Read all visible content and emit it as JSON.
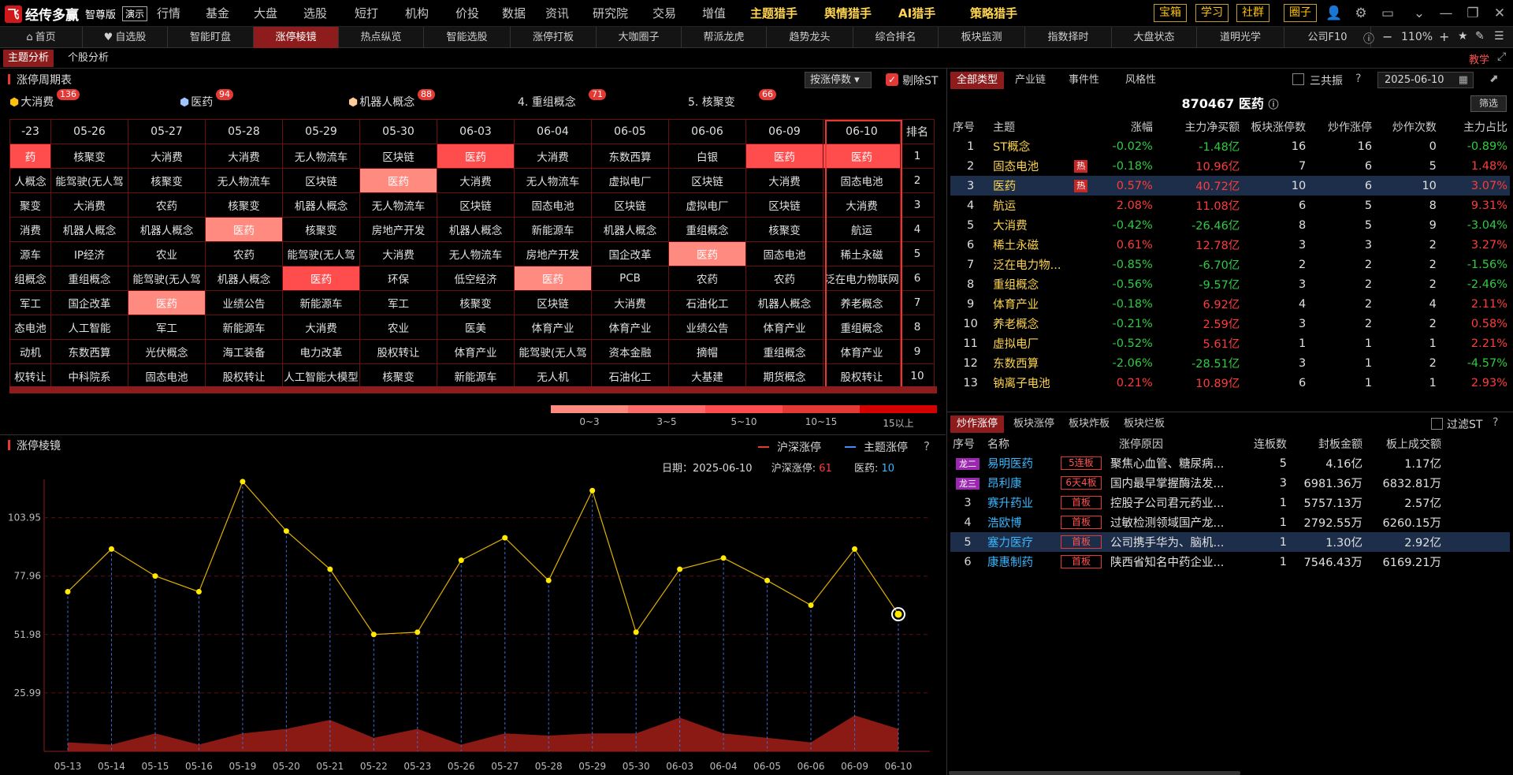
{
  "app": {
    "logo": "经传多赢",
    "edition": "智尊版",
    "demo": "演示"
  },
  "menu": [
    "行情",
    "基金",
    "大盘",
    "选股",
    "短打",
    "机构",
    "价投",
    "数据",
    "资讯",
    "研究院",
    "交易",
    "增值",
    "主题猎手",
    "舆情猎手",
    "AI猎手",
    "策略猎手"
  ],
  "top_buttons": [
    "宝箱",
    "学习",
    "社群",
    "圈子"
  ],
  "tabs": [
    "首页",
    "自选股",
    "智能盯盘",
    "涨停棱镜",
    "热点纵览",
    "智能选股",
    "涨停打板",
    "大咖圈子",
    "帮派龙虎",
    "趋势龙头",
    "综合排名",
    "板块监测",
    "指数择时",
    "大盘状态",
    "道明光学",
    "公司F10"
  ],
  "zoom": "110%",
  "teach": "教学",
  "subtabs": [
    "主题分析",
    "个股分析"
  ],
  "cycle": {
    "title": "涨停周期表",
    "sort": "按涨停数",
    "exclude_st": "剔除ST",
    "cats": [
      {
        "label": "大消费",
        "count": "136"
      },
      {
        "label": "医药",
        "count": "94"
      },
      {
        "label": "机器人概念",
        "count": "88"
      },
      {
        "label": "4. 重组概念",
        "count": "71"
      },
      {
        "label": "5. 核聚变",
        "count": "66"
      }
    ],
    "dates": [
      "-23",
      "05-26",
      "05-27",
      "05-28",
      "05-29",
      "05-30",
      "06-03",
      "06-04",
      "06-05",
      "06-06",
      "06-09",
      "06-10"
    ],
    "rank_header": "排名",
    "rows": [
      [
        "药",
        "核聚变",
        "大消费",
        "大消费",
        "无人物流车",
        "区块链",
        "医药",
        "大消费",
        "东数西算",
        "白银",
        "医药",
        "医药"
      ],
      [
        "人概念",
        "能驾驶(无人驾",
        "核聚变",
        "无人物流车",
        "区块链",
        "医药",
        "大消费",
        "无人物流车",
        "虚拟电厂",
        "区块链",
        "大消费",
        "固态电池"
      ],
      [
        "聚变",
        "大消费",
        "农药",
        "核聚变",
        "机器人概念",
        "无人物流车",
        "区块链",
        "固态电池",
        "区块链",
        "虚拟电厂",
        "区块链",
        "大消费"
      ],
      [
        "消费",
        "机器人概念",
        "机器人概念",
        "医药",
        "核聚变",
        "房地产开发",
        "机器人概念",
        "新能源车",
        "机器人概念",
        "重组概念",
        "核聚变",
        "航运"
      ],
      [
        "源车",
        "IP经济",
        "农业",
        "农药",
        "能驾驶(无人驾",
        "大消费",
        "无人物流车",
        "房地产开发",
        "国企改革",
        "医药",
        "固态电池",
        "稀土永磁"
      ],
      [
        "组概念",
        "重组概念",
        "能驾驶(无人驾",
        "机器人概念",
        "医药",
        "环保",
        "低空经济",
        "医药",
        "PCB",
        "农药",
        "农药",
        "泛在电力物联网"
      ],
      [
        "军工",
        "国企改革",
        "医药",
        "业绩公告",
        "新能源车",
        "军工",
        "核聚变",
        "区块链",
        "大消费",
        "石油化工",
        "机器人概念",
        "养老概念"
      ],
      [
        "态电池",
        "人工智能",
        "军工",
        "新能源车",
        "大消费",
        "农业",
        "医美",
        "体育产业",
        "体育产业",
        "业绩公告",
        "体育产业",
        "重组概念"
      ],
      [
        "动机",
        "东数西算",
        "光伏概念",
        "海工装备",
        "电力改革",
        "股权转让",
        "体育产业",
        "能驾驶(无人驾",
        "资本金融",
        "摘帽",
        "重组概念",
        "体育产业"
      ],
      [
        "权转让",
        "中科院系",
        "固态电池",
        "股权转让",
        "人工智能大模型",
        "核聚变",
        "新能源车",
        "无人机",
        "石油化工",
        "大基建",
        "期货概念",
        "股权转让"
      ]
    ],
    "hl": [
      [
        "r1",
        0,
        0
      ],
      [
        "r1",
        0,
        6
      ],
      [
        "r1",
        0,
        10
      ],
      [
        "r1",
        0,
        11
      ],
      [
        "r2",
        1,
        5
      ],
      [
        "r2",
        3,
        3
      ],
      [
        "r2",
        4,
        9
      ],
      [
        "r1",
        5,
        4
      ],
      [
        "r2",
        5,
        7
      ],
      [
        "r2",
        6,
        2
      ]
    ],
    "legend": [
      "0~3",
      "3~5",
      "5~10",
      "10~15",
      "15以上"
    ],
    "legend_colors": [
      "#ff8a80",
      "#ff6b6b",
      "#ff4d4d",
      "#e53935",
      "#d50000"
    ]
  },
  "prism": {
    "title": "涨停棱镜",
    "legend_a": "沪深涨停",
    "legend_b": "主题涨停",
    "date_label": "日期：",
    "date": "2025-06-10",
    "hs_label": "沪深涨停:",
    "hs_value": "61",
    "theme_label": "医药:",
    "theme_value": "10"
  },
  "chart_data": {
    "type": "line",
    "x": [
      "05-13",
      "05-14",
      "05-15",
      "05-16",
      "05-19",
      "05-20",
      "05-21",
      "05-22",
      "05-23",
      "05-26",
      "05-27",
      "05-28",
      "05-29",
      "05-30",
      "06-03",
      "06-04",
      "06-05",
      "06-06",
      "06-09",
      "06-10"
    ],
    "yticks": [
      "103.95",
      "77.96",
      "51.98",
      "25.99"
    ],
    "ylim": [
      0,
      121
    ],
    "series": [
      {
        "name": "沪深涨停",
        "values": [
          71,
          90,
          78,
          71,
          120,
          98,
          81,
          52,
          53,
          85,
          95,
          76,
          116,
          53,
          81,
          86,
          76,
          65,
          90,
          61
        ]
      },
      {
        "name": "主题涨停",
        "values": [
          4,
          3,
          8,
          3,
          8,
          10,
          14,
          6,
          10,
          3,
          8,
          7,
          8,
          8,
          15,
          8,
          6,
          4,
          16,
          10
        ]
      }
    ]
  },
  "theme_panel": {
    "tabs": [
      "全部类型",
      "产业链",
      "事件性",
      "风格性"
    ],
    "sanguo": "三共振",
    "date": "2025-06-10",
    "filter": "筛选",
    "stock": "870467 医药",
    "headers": [
      "序号",
      "主题",
      "涨幅",
      "主力净买额",
      "板块涨停数",
      "炒作涨停",
      "炒作次数",
      "主力占比"
    ],
    "rows": [
      [
        "1",
        "ST概念",
        "",
        "-0.02%",
        "-1.48亿",
        "16",
        "16",
        "0",
        "-0.89%"
      ],
      [
        "2",
        "固态电池",
        "热",
        "-0.18%",
        "10.96亿",
        "7",
        "6",
        "5",
        "1.48%"
      ],
      [
        "3",
        "医药",
        "热",
        "0.57%",
        "40.72亿",
        "10",
        "6",
        "10",
        "3.07%"
      ],
      [
        "4",
        "航运",
        "",
        "2.08%",
        "11.08亿",
        "6",
        "5",
        "8",
        "9.31%"
      ],
      [
        "5",
        "大消费",
        "",
        "-0.42%",
        "-26.46亿",
        "8",
        "5",
        "9",
        "-3.04%"
      ],
      [
        "6",
        "稀土永磁",
        "",
        "0.61%",
        "12.78亿",
        "3",
        "3",
        "2",
        "3.27%"
      ],
      [
        "7",
        "泛在电力物...",
        "",
        "-0.85%",
        "-6.70亿",
        "2",
        "2",
        "2",
        "-1.56%"
      ],
      [
        "8",
        "重组概念",
        "",
        "-0.56%",
        "-9.57亿",
        "3",
        "2",
        "2",
        "-2.46%"
      ],
      [
        "9",
        "体育产业",
        "",
        "-0.18%",
        "6.92亿",
        "4",
        "2",
        "4",
        "2.11%"
      ],
      [
        "10",
        "养老概念",
        "",
        "-0.21%",
        "2.59亿",
        "3",
        "2",
        "2",
        "0.58%"
      ],
      [
        "11",
        "虚拟电厂",
        "",
        "-0.52%",
        "5.61亿",
        "1",
        "1",
        "1",
        "2.21%"
      ],
      [
        "12",
        "东数西算",
        "",
        "-2.06%",
        "-28.51亿",
        "3",
        "1",
        "2",
        "-4.57%"
      ],
      [
        "13",
        "钠离子电池",
        "",
        "0.21%",
        "10.89亿",
        "6",
        "1",
        "1",
        "2.93%"
      ]
    ]
  },
  "stock_panel": {
    "tabs": [
      "炒作涨停",
      "板块涨停",
      "板块炸板",
      "板块烂板"
    ],
    "filter_st": "过滤ST",
    "headers": [
      "序号",
      "名称",
      "涨停原因",
      "连板数",
      "封板金额",
      "板上成交额"
    ],
    "rows": [
      [
        "龙二",
        "易明医药",
        "5连板",
        "聚焦心血管、糖尿病...",
        "5",
        "4.16亿",
        "1.17亿"
      ],
      [
        "龙三",
        "昂利康",
        "6天4板",
        "国内最早掌握酶法发...",
        "3",
        "6981.36万",
        "6832.81万"
      ],
      [
        "3",
        "赛升药业",
        "首板",
        "控股子公司君元药业...",
        "1",
        "5757.13万",
        "2.57亿"
      ],
      [
        "4",
        "浩欧博",
        "首板",
        "过敏检测领域国产龙...",
        "1",
        "2792.55万",
        "6260.15万"
      ],
      [
        "5",
        "塞力医疗",
        "首板",
        "公司携手华为、脑机...",
        "1",
        "1.30亿",
        "2.92亿"
      ],
      [
        "6",
        "康惠制药",
        "首板",
        "陕西省知名中药企业...",
        "1",
        "7546.43万",
        "6169.21万"
      ]
    ]
  }
}
